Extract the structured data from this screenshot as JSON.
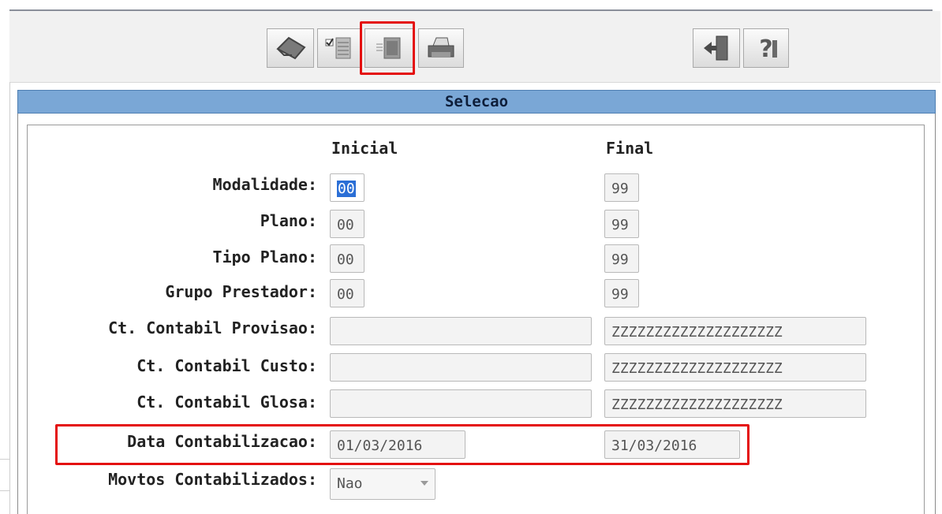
{
  "panel": {
    "title": "Selecao"
  },
  "columns": {
    "initial": "Inicial",
    "final": "Final"
  },
  "rows": [
    {
      "label": "Modalidade:",
      "initial": "00",
      "final": "99"
    },
    {
      "label": "Plano:",
      "initial": "00",
      "final": "99"
    },
    {
      "label": "Tipo Plano:",
      "initial": "00",
      "final": "99"
    },
    {
      "label": "Grupo Prestador:",
      "initial": "00",
      "final": "99"
    },
    {
      "label": "Ct. Contabil Provisao:",
      "initial": "",
      "final": "ZZZZZZZZZZZZZZZZZZZZ"
    },
    {
      "label": "Ct. Contabil Custo:",
      "initial": "",
      "final": "ZZZZZZZZZZZZZZZZZZZZ"
    },
    {
      "label": "Ct. Contabil Glosa:",
      "initial": "",
      "final": "ZZZZZZZZZZZZZZZZZZZZ"
    },
    {
      "label": "Data Contabilizacao:",
      "initial": "01/03/2016",
      "final": "31/03/2016"
    },
    {
      "label": "Movtos Contabilizados:",
      "selected": "Nao"
    }
  ],
  "toolbar": {
    "icons": [
      "eraser-icon",
      "checklist-icon",
      "list-icon",
      "print-icon",
      "exit-door-icon",
      "help-question-icon"
    ]
  },
  "colors": {
    "title_bar": "#7aa7d6",
    "highlight": "#e41010",
    "selection": "#2b6fd6"
  }
}
